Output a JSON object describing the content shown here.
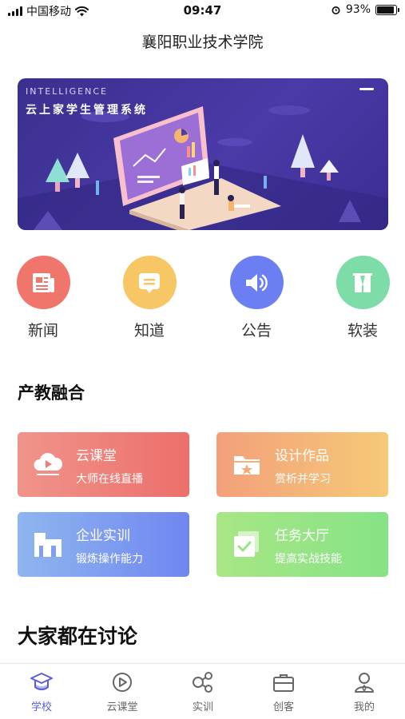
{
  "status_bar": {
    "carrier": "中国移动",
    "time": "09:47",
    "battery": "93%",
    "battery_level": 0.93
  },
  "header": {
    "title": "襄阳职业技术学院"
  },
  "banner": {
    "tag": "INTELLIGENCE",
    "title": "云上家学生管理系统"
  },
  "quick_links": [
    {
      "label": "新闻",
      "icon": "newspaper-icon",
      "color": "#f0756a"
    },
    {
      "label": "知道",
      "icon": "message-icon",
      "color": "#f7c765"
    },
    {
      "label": "公告",
      "icon": "speaker-icon",
      "color": "#6b7ff2"
    },
    {
      "label": "软装",
      "icon": "window-icon",
      "color": "#7ddca8"
    }
  ],
  "sections": {
    "industry": "产教融合",
    "discussion": "大家都在讨论"
  },
  "cards": [
    {
      "title": "云课堂",
      "subtitle": "大师在线直播",
      "icon": "cloud-play-icon",
      "gradient": [
        "#f0948a",
        "#ec6f6b"
      ]
    },
    {
      "title": "设计作品",
      "subtitle": "赏析并学习",
      "icon": "folder-star-icon",
      "gradient": [
        "#f3a07a",
        "#f6c978"
      ]
    },
    {
      "title": "企业实训",
      "subtitle": "锻炼操作能力",
      "icon": "building-icon",
      "gradient": [
        "#8fb6ef",
        "#6f86f0"
      ]
    },
    {
      "title": "任务大厅",
      "subtitle": "提高实战技能",
      "icon": "task-check-icon",
      "gradient": [
        "#a8e685",
        "#86e386"
      ]
    }
  ],
  "tabbar": {
    "active_color": "#5a5fd8",
    "items": [
      {
        "label": "学校",
        "icon": "graduation-cap-icon",
        "active": true
      },
      {
        "label": "云课堂",
        "icon": "play-circle-icon",
        "active": false
      },
      {
        "label": "实训",
        "icon": "share-nodes-icon",
        "active": false
      },
      {
        "label": "创客",
        "icon": "briefcase-icon",
        "active": false
      },
      {
        "label": "我的",
        "icon": "user-icon",
        "active": false
      }
    ]
  }
}
